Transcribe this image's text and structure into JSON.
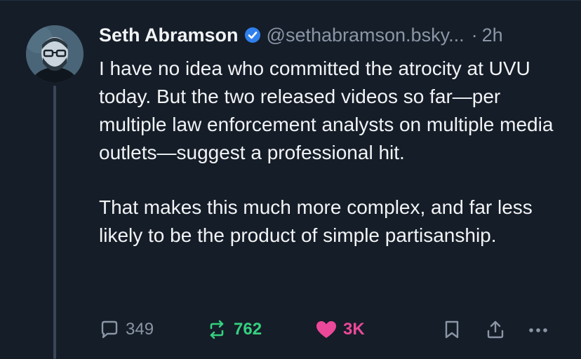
{
  "post": {
    "author_name": "Seth Abramson",
    "handle": "@sethabramson.bsky...",
    "separator": "·",
    "time": "2h",
    "paragraphs": [
      "I have no idea who committed the atrocity at UVU today. But the two released videos so far—per multiple law enforcement analysts on multiple media outlets—suggest a professional hit.",
      "That makes this much more complex, and far less likely to be the product of simple partisanship."
    ]
  },
  "actions": {
    "reply_count": "349",
    "repost_count": "762",
    "like_count": "3K"
  },
  "icons": {
    "verified": "verified-badge-icon",
    "reply": "speech-bubble-icon",
    "repost": "repost-arrows-icon",
    "like": "heart-icon",
    "bookmark": "bookmark-icon",
    "share": "share-upload-icon",
    "more": "more-horizontal-icon"
  },
  "colors": {
    "background": "#151d28",
    "text": "#f1f3f5",
    "muted": "#8a96a6",
    "verified": "#2f80ed",
    "repost": "#35d07f",
    "like": "#ec4899"
  }
}
